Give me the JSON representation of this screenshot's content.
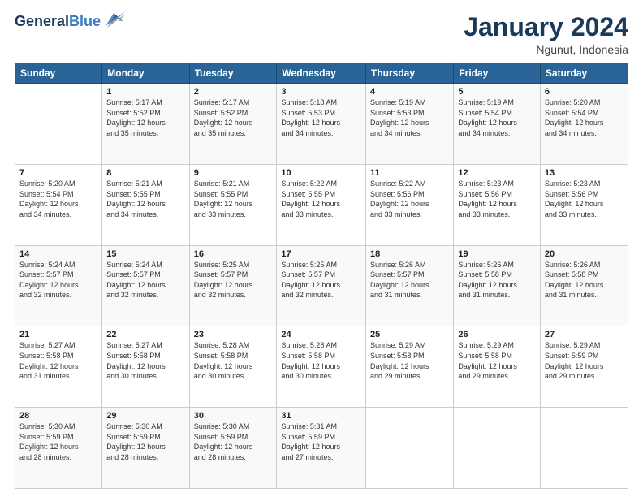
{
  "header": {
    "logo_line1": "General",
    "logo_line2": "Blue",
    "title": "January 2024",
    "subtitle": "Ngunut, Indonesia"
  },
  "columns": [
    "Sunday",
    "Monday",
    "Tuesday",
    "Wednesday",
    "Thursday",
    "Friday",
    "Saturday"
  ],
  "weeks": [
    [
      {
        "num": "",
        "info": ""
      },
      {
        "num": "1",
        "info": "Sunrise: 5:17 AM\nSunset: 5:52 PM\nDaylight: 12 hours\nand 35 minutes."
      },
      {
        "num": "2",
        "info": "Sunrise: 5:17 AM\nSunset: 5:52 PM\nDaylight: 12 hours\nand 35 minutes."
      },
      {
        "num": "3",
        "info": "Sunrise: 5:18 AM\nSunset: 5:53 PM\nDaylight: 12 hours\nand 34 minutes."
      },
      {
        "num": "4",
        "info": "Sunrise: 5:19 AM\nSunset: 5:53 PM\nDaylight: 12 hours\nand 34 minutes."
      },
      {
        "num": "5",
        "info": "Sunrise: 5:19 AM\nSunset: 5:54 PM\nDaylight: 12 hours\nand 34 minutes."
      },
      {
        "num": "6",
        "info": "Sunrise: 5:20 AM\nSunset: 5:54 PM\nDaylight: 12 hours\nand 34 minutes."
      }
    ],
    [
      {
        "num": "7",
        "info": "Sunrise: 5:20 AM\nSunset: 5:54 PM\nDaylight: 12 hours\nand 34 minutes."
      },
      {
        "num": "8",
        "info": "Sunrise: 5:21 AM\nSunset: 5:55 PM\nDaylight: 12 hours\nand 34 minutes."
      },
      {
        "num": "9",
        "info": "Sunrise: 5:21 AM\nSunset: 5:55 PM\nDaylight: 12 hours\nand 33 minutes."
      },
      {
        "num": "10",
        "info": "Sunrise: 5:22 AM\nSunset: 5:55 PM\nDaylight: 12 hours\nand 33 minutes."
      },
      {
        "num": "11",
        "info": "Sunrise: 5:22 AM\nSunset: 5:56 PM\nDaylight: 12 hours\nand 33 minutes."
      },
      {
        "num": "12",
        "info": "Sunrise: 5:23 AM\nSunset: 5:56 PM\nDaylight: 12 hours\nand 33 minutes."
      },
      {
        "num": "13",
        "info": "Sunrise: 5:23 AM\nSunset: 5:56 PM\nDaylight: 12 hours\nand 33 minutes."
      }
    ],
    [
      {
        "num": "14",
        "info": "Sunrise: 5:24 AM\nSunset: 5:57 PM\nDaylight: 12 hours\nand 32 minutes."
      },
      {
        "num": "15",
        "info": "Sunrise: 5:24 AM\nSunset: 5:57 PM\nDaylight: 12 hours\nand 32 minutes."
      },
      {
        "num": "16",
        "info": "Sunrise: 5:25 AM\nSunset: 5:57 PM\nDaylight: 12 hours\nand 32 minutes."
      },
      {
        "num": "17",
        "info": "Sunrise: 5:25 AM\nSunset: 5:57 PM\nDaylight: 12 hours\nand 32 minutes."
      },
      {
        "num": "18",
        "info": "Sunrise: 5:26 AM\nSunset: 5:57 PM\nDaylight: 12 hours\nand 31 minutes."
      },
      {
        "num": "19",
        "info": "Sunrise: 5:26 AM\nSunset: 5:58 PM\nDaylight: 12 hours\nand 31 minutes."
      },
      {
        "num": "20",
        "info": "Sunrise: 5:26 AM\nSunset: 5:58 PM\nDaylight: 12 hours\nand 31 minutes."
      }
    ],
    [
      {
        "num": "21",
        "info": "Sunrise: 5:27 AM\nSunset: 5:58 PM\nDaylight: 12 hours\nand 31 minutes."
      },
      {
        "num": "22",
        "info": "Sunrise: 5:27 AM\nSunset: 5:58 PM\nDaylight: 12 hours\nand 30 minutes."
      },
      {
        "num": "23",
        "info": "Sunrise: 5:28 AM\nSunset: 5:58 PM\nDaylight: 12 hours\nand 30 minutes."
      },
      {
        "num": "24",
        "info": "Sunrise: 5:28 AM\nSunset: 5:58 PM\nDaylight: 12 hours\nand 30 minutes."
      },
      {
        "num": "25",
        "info": "Sunrise: 5:29 AM\nSunset: 5:58 PM\nDaylight: 12 hours\nand 29 minutes."
      },
      {
        "num": "26",
        "info": "Sunrise: 5:29 AM\nSunset: 5:58 PM\nDaylight: 12 hours\nand 29 minutes."
      },
      {
        "num": "27",
        "info": "Sunrise: 5:29 AM\nSunset: 5:59 PM\nDaylight: 12 hours\nand 29 minutes."
      }
    ],
    [
      {
        "num": "28",
        "info": "Sunrise: 5:30 AM\nSunset: 5:59 PM\nDaylight: 12 hours\nand 28 minutes."
      },
      {
        "num": "29",
        "info": "Sunrise: 5:30 AM\nSunset: 5:59 PM\nDaylight: 12 hours\nand 28 minutes."
      },
      {
        "num": "30",
        "info": "Sunrise: 5:30 AM\nSunset: 5:59 PM\nDaylight: 12 hours\nand 28 minutes."
      },
      {
        "num": "31",
        "info": "Sunrise: 5:31 AM\nSunset: 5:59 PM\nDaylight: 12 hours\nand 27 minutes."
      },
      {
        "num": "",
        "info": ""
      },
      {
        "num": "",
        "info": ""
      },
      {
        "num": "",
        "info": ""
      }
    ]
  ]
}
